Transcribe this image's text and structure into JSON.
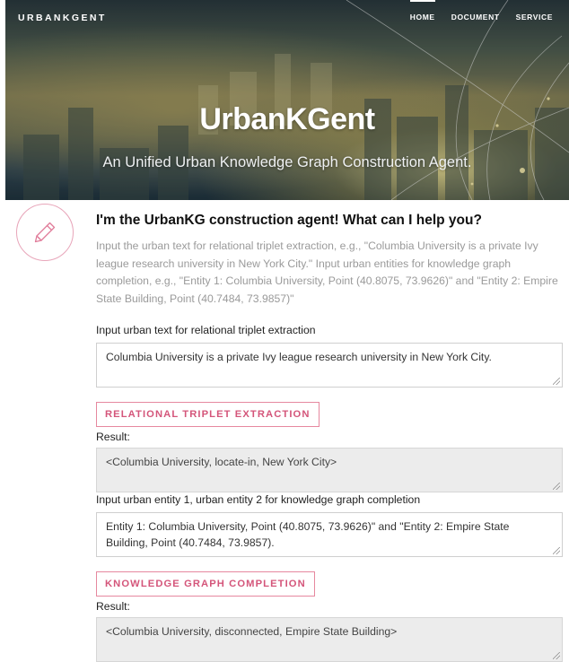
{
  "header": {
    "brand": "URBANKGENT",
    "nav": [
      {
        "label": "HOME",
        "active": true
      },
      {
        "label": "DOCUMENT",
        "active": false
      },
      {
        "label": "SERVICE",
        "active": false
      }
    ],
    "title": "UrbanKGent",
    "subtitle": "An Unified Urban Knowledge Graph Construction Agent."
  },
  "agent": {
    "icon": "pencil-icon",
    "heading": "I'm the UrbanKG construction agent! What can I help you?",
    "intro": "Input the urban text for relational triplet extraction, e.g., \"Columbia University is a private Ivy league research university in New York City.\" Input urban entities for knowledge graph completion, e.g., \"Entity 1: Columbia University, Point (40.8075, 73.9626)\" and \"Entity 2: Empire State Building, Point (40.7484, 73.9857)\""
  },
  "triplet": {
    "input_label": "Input urban text for relational triplet extraction",
    "input_value": "Columbia University is a private Ivy league research university in New York City.",
    "button_label": "RELATIONAL TRIPLET EXTRACTION",
    "result_label": "Result:",
    "result_value": "<Columbia University, locate-in, New York City>"
  },
  "completion": {
    "input_label": "Input urban entity 1, urban entity 2 for knowledge graph completion",
    "input_value": "Entity 1: Columbia University, Point (40.8075, 73.9626)\" and \"Entity 2: Empire State Building, Point (40.7484, 73.9857).",
    "button_label": "KNOWLEDGE GRAPH COMPLETION",
    "result_label": "Result:",
    "result_value": "<Columbia University, disconnected, Empire State Building>"
  },
  "colors": {
    "accent": "#d4557a",
    "accent_border": "#e6889f",
    "muted_text": "#9a9a9a",
    "result_bg": "#ececec"
  }
}
